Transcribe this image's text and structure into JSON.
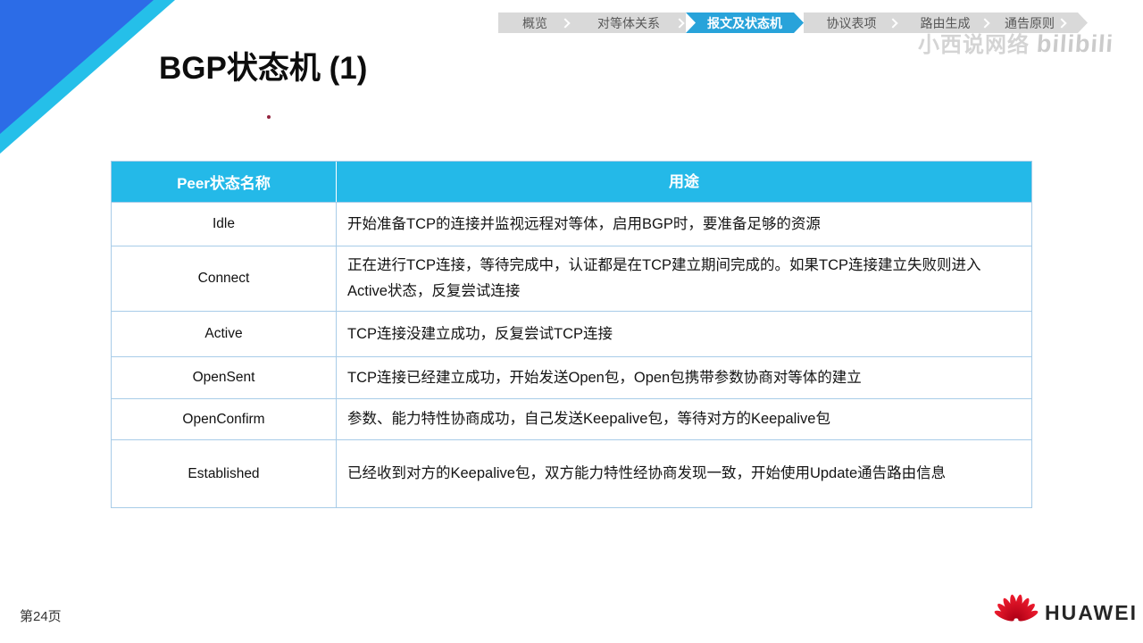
{
  "title": "BGP状态机 (1)",
  "nav": {
    "items": [
      {
        "label": "概览",
        "active": false
      },
      {
        "label": "对等体关系",
        "active": false
      },
      {
        "label": "报文及状态机",
        "active": true
      },
      {
        "label": "协议表项",
        "active": false
      },
      {
        "label": "路由生成",
        "active": false
      },
      {
        "label": "通告原则",
        "active": false
      }
    ]
  },
  "watermark": {
    "channel": "小西说网络",
    "platform": "bilibili"
  },
  "table": {
    "headers": [
      "Peer状态名称",
      "用途"
    ],
    "rows": [
      {
        "state": "Idle",
        "desc": "开始准备TCP的连接并监视远程对等体，启用BGP时，要准备足够的资源"
      },
      {
        "state": "Connect",
        "desc": "正在进行TCP连接，等待完成中，认证都是在TCP建立期间完成的。如果TCP连接建立失败则进入Active状态，反复尝试连接"
      },
      {
        "state": "Active",
        "desc": "TCP连接没建立成功，反复尝试TCP连接"
      },
      {
        "state": "OpenSent",
        "desc": "TCP连接已经建立成功，开始发送Open包，Open包携带参数协商对等体的建立"
      },
      {
        "state": "OpenConfirm",
        "desc": "参数、能力特性协商成功，自己发送Keepalive包，等待对方的Keepalive包"
      },
      {
        "state": "Established",
        "desc": "已经收到对方的Keepalive包，双方能力特性经协商发现一致，开始使用Update通告路由信息"
      }
    ]
  },
  "footer": {
    "page_label": "第24页",
    "brand": "HUAWEI"
  },
  "colors": {
    "table_header_cyan": "#24b9e8",
    "nav_active_blue": "#28a3da",
    "corner_blue": "#2c6ce7",
    "corner_cyan": "#25bfe9",
    "table_border": "#a8cce8",
    "huawei_red": "#d50f25"
  }
}
